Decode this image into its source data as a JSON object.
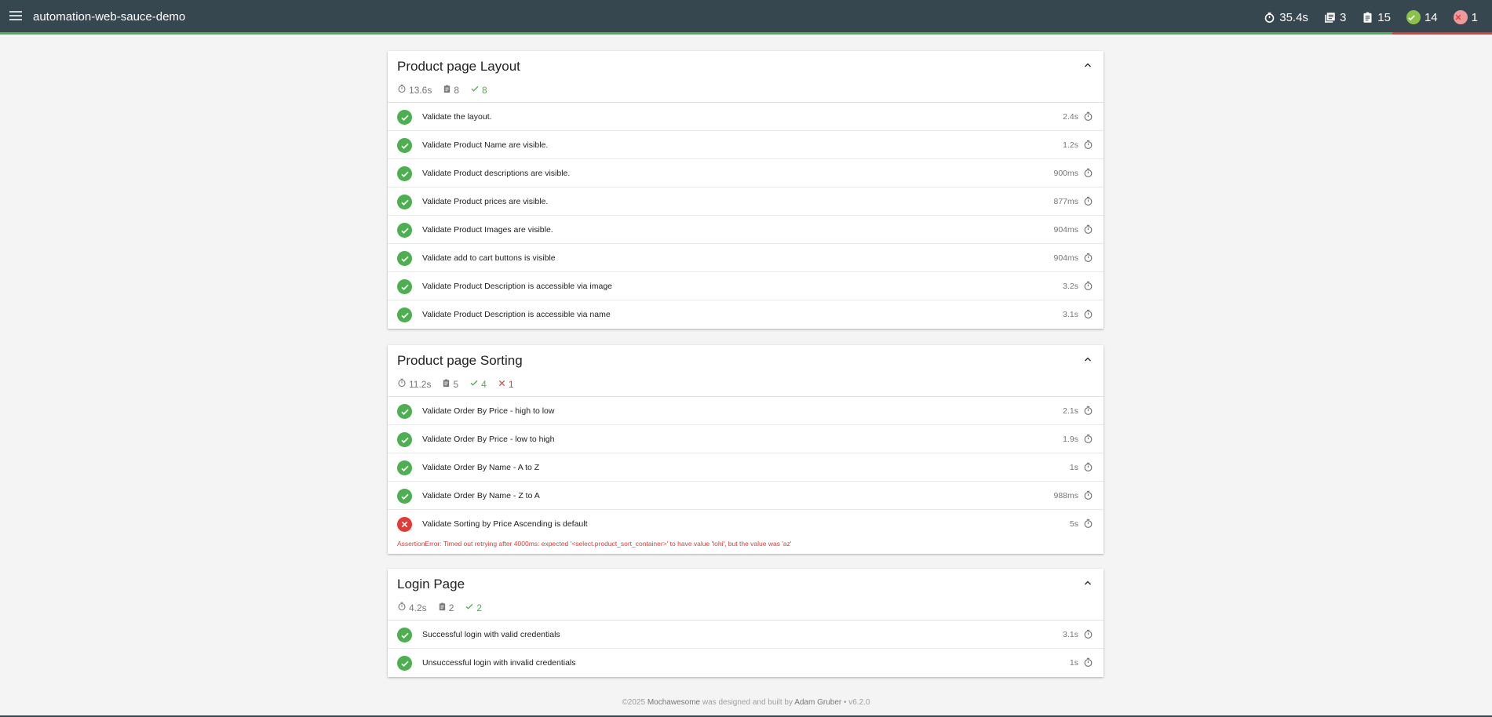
{
  "navbar": {
    "title": "automation-web-sauce-demo",
    "stats": {
      "duration": "35.4s",
      "suites": "3",
      "tests": "15",
      "passes": "14",
      "failures": "1"
    },
    "progress": {
      "pass_fraction": 0.933,
      "fail_fraction": 0.067
    }
  },
  "suites": [
    {
      "title": "Product page Layout",
      "duration": "13.6s",
      "tests": "8",
      "passes": "8",
      "failures": null,
      "items": [
        {
          "title": "Validate the layout.",
          "duration": "2.4s",
          "state": "passed"
        },
        {
          "title": "Validate Product Name are visible.",
          "duration": "1.2s",
          "state": "passed"
        },
        {
          "title": "Validate Product descriptions are visible.",
          "duration": "900ms",
          "state": "passed"
        },
        {
          "title": "Validate Product prices are visible.",
          "duration": "877ms",
          "state": "passed"
        },
        {
          "title": "Validate Product Images are visible.",
          "duration": "904ms",
          "state": "passed"
        },
        {
          "title": "Validate add to cart buttons is visible",
          "duration": "904ms",
          "state": "passed"
        },
        {
          "title": "Validate Product Description is accessible via image",
          "duration": "3.2s",
          "state": "passed"
        },
        {
          "title": "Validate Product Description is accessible via name",
          "duration": "3.1s",
          "state": "passed"
        }
      ]
    },
    {
      "title": "Product page Sorting",
      "duration": "11.2s",
      "tests": "5",
      "passes": "4",
      "failures": "1",
      "items": [
        {
          "title": "Validate Order By Price - high to low",
          "duration": "2.1s",
          "state": "passed"
        },
        {
          "title": "Validate Order By Price - low to high",
          "duration": "1.9s",
          "state": "passed"
        },
        {
          "title": "Validate Order By Name - A to Z",
          "duration": "1s",
          "state": "passed"
        },
        {
          "title": "Validate Order By Name - Z to A",
          "duration": "988ms",
          "state": "passed"
        },
        {
          "title": "Validate Sorting by Price Ascending is default",
          "duration": "5s",
          "state": "failed",
          "error": "AssertionError: Timed out retrying after 4000ms: expected '<select.product_sort_container>' to have value 'lohi', but the value was 'az'"
        }
      ]
    },
    {
      "title": "Login Page",
      "duration": "4.2s",
      "tests": "2",
      "passes": "2",
      "failures": null,
      "items": [
        {
          "title": "Successful login with valid credentials",
          "duration": "3.1s",
          "state": "passed"
        },
        {
          "title": "Unsuccessful login with invalid credentials",
          "duration": "1s",
          "state": "passed"
        }
      ]
    }
  ],
  "footer": {
    "copyright": "©2025",
    "brand": "Mochawesome",
    "middle": "was designed and built by",
    "author": "Adam Gruber",
    "version": "• v6.2.0"
  },
  "colors": {
    "navbar": "#37474f",
    "pass": "#4caf50",
    "fail": "#e53935"
  }
}
